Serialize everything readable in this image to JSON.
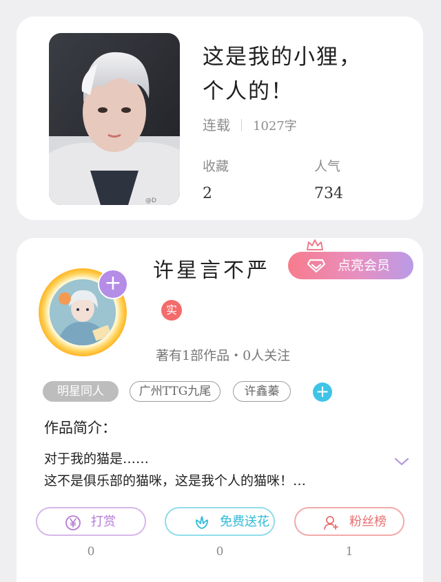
{
  "book": {
    "title_line1": "这是我的小狸，",
    "title_line2": "个人的！",
    "status": "连载",
    "word_count": "1027字",
    "favorites_label": "收藏",
    "favorites_value": "2",
    "popularity_label": "人气",
    "popularity_value": "734",
    "cover_watermark": "@D"
  },
  "author": {
    "name": "许星言不严",
    "vip_label": "点亮会员",
    "real_badge": "实",
    "works_info": "著有1部作品・0人关注",
    "avatar_plus": "+"
  },
  "tags": [
    "明星同人",
    "广州TTG九尾",
    "许鑫蓁"
  ],
  "tag_add": "+",
  "intro": {
    "heading": "作品简介：",
    "line1": "对于我的猫是……",
    "line2": "这不是俱乐部的猫咪，这是我个人的猫咪！…"
  },
  "actions": [
    {
      "label": "打赏",
      "count": "0",
      "icon": "yen-icon",
      "color": "#b47ad6"
    },
    {
      "label": "免费送花",
      "count": "0",
      "icon": "flower-icon",
      "color": "#2fbad8"
    },
    {
      "label": "粉丝榜",
      "count": "1",
      "icon": "fans-icon",
      "color": "#e96e6e"
    }
  ]
}
